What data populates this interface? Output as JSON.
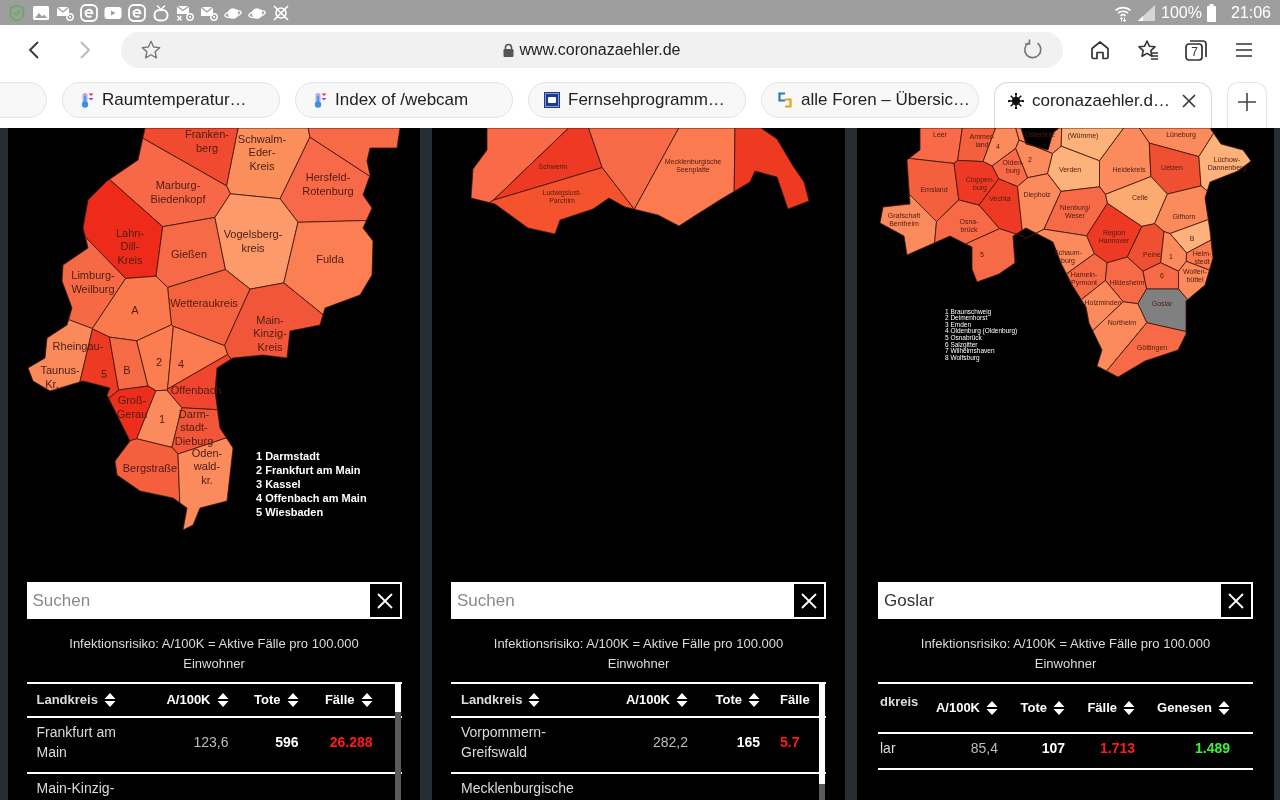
{
  "status_bar": {
    "battery": "100%",
    "time": "21:06"
  },
  "toolbar": {
    "nav_buttons": [
      {
        "disabled": false
      },
      {
        "disabled": true
      }
    ],
    "address": {
      "url": "www.coronazaehler.de"
    },
    "tab_count": "7"
  },
  "tabs": [
    {
      "selected": false
    },
    {
      "title": "Raumtemperatur…",
      "selected": false
    },
    {
      "title": "Index of /webcam",
      "selected": false
    },
    {
      "title": "Fernsehprogramm…",
      "selected": false
    },
    {
      "title": "alle Foren – Übersic…",
      "selected": false
    },
    {
      "title": "coronazaehler.d…",
      "selected": true
    }
  ],
  "panels": [
    {
      "map": {
        "regions": [
          {
            "label": "Franken-\nberg",
            "color": "#f04a30"
          },
          {
            "label": "Schwalm-\nEder-\nKreis",
            "color": "#fb8f5c"
          },
          {
            "color": "#f76a48"
          },
          {
            "label": "Hersfeld-\nRotenburg",
            "color": "#f8694a"
          },
          {
            "label": "Marburg-\nBiedenkopf",
            "color": "#f76848"
          },
          {
            "label": "Lahn-\nDill-\nKreis",
            "color": "#ee2b1a"
          },
          {
            "label": "Gießen",
            "color": "#f76a47"
          },
          {
            "label": "Vogelsberg-\nkreis",
            "color": "#fc9a6b"
          },
          {
            "label": "Fulda",
            "color": "#fb7f53"
          },
          {
            "label": "Limburg-\nWeilburg",
            "color": "#f56a45"
          },
          {
            "label": "Wetteraukreis",
            "color": "#f4623f"
          },
          {
            "label": "A",
            "color": "#fb7a4d"
          },
          {
            "label": "Main-\nKinzig-\nKreis",
            "color": "#f2563a"
          },
          {
            "label": "Rheingau-\nTaunus-\nKr.",
            "color": "#fb8a5a"
          },
          {
            "label": "5",
            "color": "#ee3a22"
          },
          {
            "label": "B",
            "color": "#f56b45"
          },
          {
            "label": "2",
            "color": "#fb7d50"
          },
          {
            "label": "4",
            "color": "#fa7c50"
          },
          {
            "label": "Offenbach",
            "color": "#f0452e"
          },
          {
            "label": "Groß-\nGerau",
            "color": "#ee2e1c"
          },
          {
            "label": "1",
            "color": "#fb8a5c"
          },
          {
            "label": "Darm-\nstadt-\nDieburg",
            "color": "#f2563a"
          },
          {
            "label": "Bergstraße",
            "color": "#f4603e"
          },
          {
            "label": "Oden-\nwald-\nkr.",
            "color": "#fb8a5c"
          }
        ],
        "legend": [
          "1 Darmstadt",
          "2 Frankfurt am Main",
          "3 Kassel",
          "4 Offenbach am Main",
          "5 Wiesbaden"
        ]
      },
      "search": {
        "placeholder": "Suchen"
      },
      "note": "Infektionsrisiko: A/100K = Aktive Fälle pro 100.000 Einwohner",
      "table": {
        "scrollbar": true,
        "columns": [
          {
            "label": "Landkreis",
            "kind": "name",
            "sort_icon": true
          },
          {
            "label": "A/100K",
            "kind": "rate",
            "sort_icon": true
          },
          {
            "label": "Tote",
            "kind": "deaths",
            "sort_icon": true
          },
          {
            "label": "Fälle",
            "kind": "cases",
            "sort_icon": true
          }
        ],
        "rows": [
          [
            "Frankfurt am Main",
            "123,6",
            "596",
            "26.288"
          ],
          [
            "Main-Kinzig-"
          ]
        ]
      }
    },
    {
      "map": {
        "regions": [
          {
            "color": "#f86a48"
          },
          {
            "label": "Schwerin",
            "color": "#ee3a25"
          },
          {
            "label": "Ludwigslust-\nParchim",
            "color": "#f4532e"
          },
          {
            "color": "#f76a48"
          },
          {
            "label": "Mecklenburgische\nSeenplatte",
            "color": "#fb7a4f"
          },
          {
            "color": "#ef3a22"
          }
        ]
      },
      "search": {
        "placeholder": "Suchen"
      },
      "note": "Infektionsrisiko: A/100K = Aktive Fälle pro 100.000 Einwohner",
      "table": {
        "scrollbar": true,
        "columns": [
          {
            "label": "Landkreis",
            "kind": "name",
            "sort_icon": true
          },
          {
            "label": "A/100K",
            "kind": "rate",
            "sort_icon": true
          },
          {
            "label": "Tote",
            "kind": "deaths",
            "sort_icon": true
          },
          {
            "label": "Fälle",
            "kind": "cases",
            "sort_icon": false
          }
        ],
        "rows": [
          [
            "Vorpommern-Greifswald",
            "282,2",
            "165",
            "5.7"
          ],
          [
            "Mecklenburgische"
          ]
        ]
      }
    },
    {
      "map": {
        "regions": [
          {
            "label": "Leer",
            "color": "#f86a48"
          },
          {
            "label": "Ammer-\nland",
            "color": "#f4603e"
          },
          {
            "label": "Osterholz",
            "color": "#fb8a5c"
          },
          {
            "label": "(Wümme)",
            "color": "#fcb27a"
          },
          {
            "label": "Lüneburg",
            "color": "#fb8a5c"
          },
          {
            "label": "4",
            "color": "#fb8a5c"
          },
          {
            "label": "Olden-\nburg",
            "color": "#f86a48"
          },
          {
            "label": "2",
            "color": "#fb8a5c"
          },
          {
            "label": "Verden",
            "color": "#fcb27a"
          },
          {
            "label": "Heidekreis",
            "color": "#fb8a5c"
          },
          {
            "label": "Uelzen",
            "color": "#f05032"
          },
          {
            "label": "Lüchow-\nDannenberg",
            "color": "#fcb27a"
          },
          {
            "label": "Emsland",
            "color": "#f4603e"
          },
          {
            "label": "Cloppen-\nburg",
            "color": "#ee3a25"
          },
          {
            "label": "Vechta",
            "color": "#ee3a25"
          },
          {
            "label": "Diepholz",
            "color": "#fb8a5c"
          },
          {
            "label": "Celle",
            "color": "#fdaa72"
          },
          {
            "label": "Grafschaft\nBentheim",
            "color": "#fb8a5c"
          },
          {
            "label": "Osna-\nbrück",
            "color": "#f76a48"
          },
          {
            "label": "Nienburg/\nWeser",
            "color": "#f76a48"
          },
          {
            "label": "Gifhorn",
            "color": "#fb8a5c"
          },
          {
            "label": "Region\nHannover",
            "color": "#ee3a25"
          },
          {
            "label": "B",
            "color": "#fcb27a"
          },
          {
            "label": "5",
            "color": "#f76a48"
          },
          {
            "label": "Schaum-\nburg",
            "color": "#fb8a5c"
          },
          {
            "label": "Peine",
            "color": "#f05032"
          },
          {
            "label": "1",
            "color": "#fb8a5c"
          },
          {
            "label": "Helm-\nstedt",
            "color": "#fb7a50"
          },
          {
            "label": "Hameln-\nPyrmont",
            "color": "#f76a48"
          },
          {
            "label": "Hildesheim",
            "color": "#f76a48"
          },
          {
            "label": "6",
            "color": "#f76a48"
          },
          {
            "label": "Wolfen-\nbüttel",
            "color": "#fb8a5c"
          },
          {
            "label": "Holzminden",
            "color": "#fb8a5c"
          },
          {
            "label": "Goslar",
            "color": "#808080"
          },
          {
            "label": "Northeim",
            "color": "#fb8a5c"
          },
          {
            "label": "Göttingen",
            "color": "#f76a48"
          }
        ],
        "legend": [
          "1 Braunschweig",
          "2 Delmenhorst",
          "3 Emden",
          "4 Oldenburg (Oldenburg)",
          "5 Osnabrück",
          "6 Salzgitter",
          "7 Wilhelmshaven",
          "8 Wolfsburg"
        ]
      },
      "search": {
        "value": "Goslar"
      },
      "note": "Infektionsrisiko: A/100K = Aktive Fälle pro 100.000 Einwohner",
      "table": {
        "scrollbar": false,
        "columns": [
          {
            "label": "dkreis",
            "kind": "name",
            "sort_icon": false
          },
          {
            "label": "A/100K",
            "kind": "rate",
            "sort_icon": true
          },
          {
            "label": "Tote",
            "kind": "deaths",
            "sort_icon": true
          },
          {
            "label": "Fälle",
            "kind": "cases",
            "sort_icon": true
          },
          {
            "label": "Genesen",
            "kind": "recovered",
            "sort_icon": true
          }
        ],
        "rows": [
          [
            "lar",
            "85,4",
            "107",
            "1.713",
            "1.489"
          ]
        ]
      }
    }
  ]
}
